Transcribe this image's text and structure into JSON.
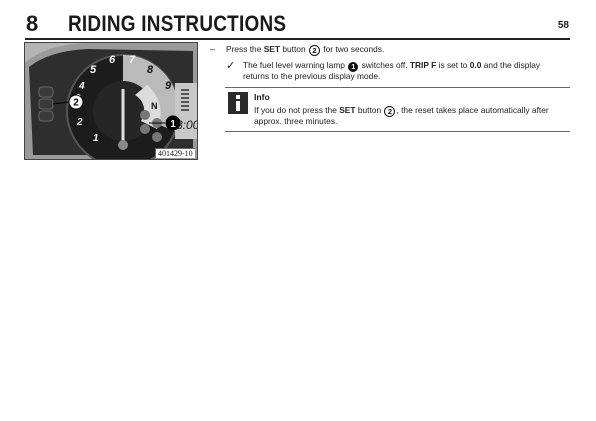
{
  "header": {
    "chapter_number": "8",
    "chapter_title": "RIDING INSTRUCTIONS",
    "page_number": "58"
  },
  "figure": {
    "label": "401429-10",
    "callouts": [
      "1",
      "2"
    ],
    "dial_numbers": [
      "1",
      "2",
      "3",
      "4",
      "5",
      "6",
      "7",
      "8",
      "9"
    ],
    "indicator_letter": "N",
    "clock_digits": "3:00"
  },
  "step": {
    "bullet": "–",
    "text_before": "Press the ",
    "set_label": "SET",
    "text_middle": " button ",
    "button_ref": "2",
    "text_after": " for two seconds."
  },
  "result": {
    "bullet": "✓",
    "line1_before": "The fuel level warning lamp ",
    "lamp_ref": "1",
    "line1_middle": " switches off. ",
    "tripf_label": "TRIP F",
    "line1_middle2": " is set to ",
    "value_label": "0.0",
    "line1_after": " and the display",
    "line2": "returns to the previous display mode."
  },
  "info": {
    "title": "Info",
    "line1_before": "If you do not press the ",
    "set_label": "SET",
    "line1_middle": " button ",
    "button_ref": "2",
    "line1_after": ", the reset takes place automatically after",
    "line2": "approx. three minutes."
  }
}
